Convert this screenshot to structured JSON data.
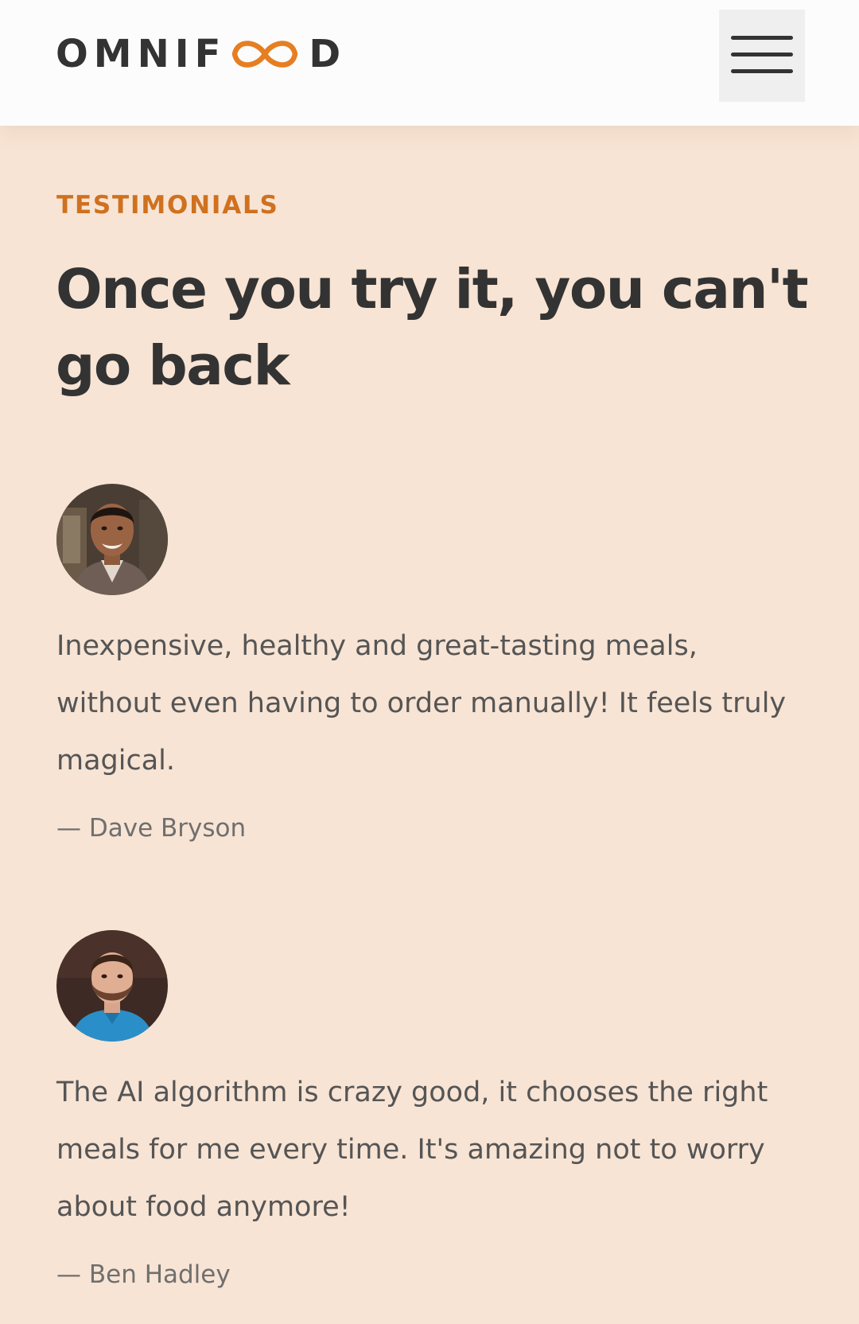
{
  "header": {
    "logo_left": "OMNIF",
    "logo_right": "D",
    "menu_button_label": "Open navigation menu"
  },
  "colors": {
    "brand": "#e67e22",
    "subheading": "#cf711f",
    "section_background": "#f8e4d4",
    "heading_text": "#333333",
    "body_text": "#555555"
  },
  "icons": {
    "logo_mark": "infinity-loop-icon",
    "menu": "hamburger-menu-icon"
  },
  "testimonials_section": {
    "subheading": "TESTIMONIALS",
    "heading": "Once you try it, you can't go back",
    "items": [
      {
        "quote": "Inexpensive, healthy and great-tasting meals, without even having to order manually! It feels truly magical.",
        "author": "— Dave Bryson"
      },
      {
        "quote": "The AI algorithm is crazy good, it chooses the right meals for me every time. It's amazing not to worry about food anymore!",
        "author": "— Ben Hadley"
      }
    ]
  }
}
